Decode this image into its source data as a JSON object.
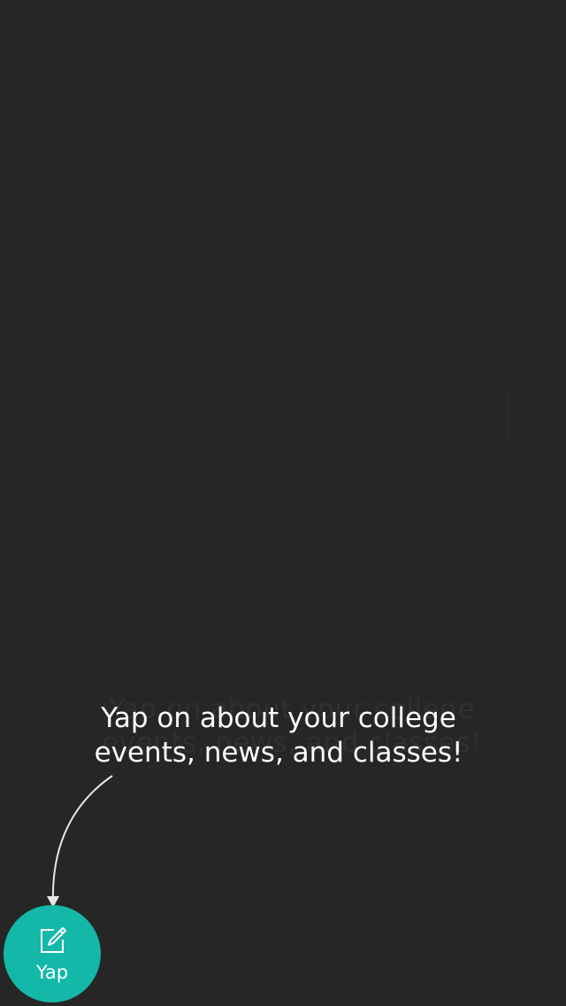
{
  "background_content": {
    "placeholder_line": "Yap on about your college events, news, and classes!"
  },
  "coachmark": {
    "message": "Yap on about your college events, news, and classes!"
  },
  "fab": {
    "label": "Yap",
    "icon": "compose-icon",
    "color": "#14b8a8"
  },
  "colors": {
    "overlay": "#262626",
    "text": "#ffffff"
  }
}
